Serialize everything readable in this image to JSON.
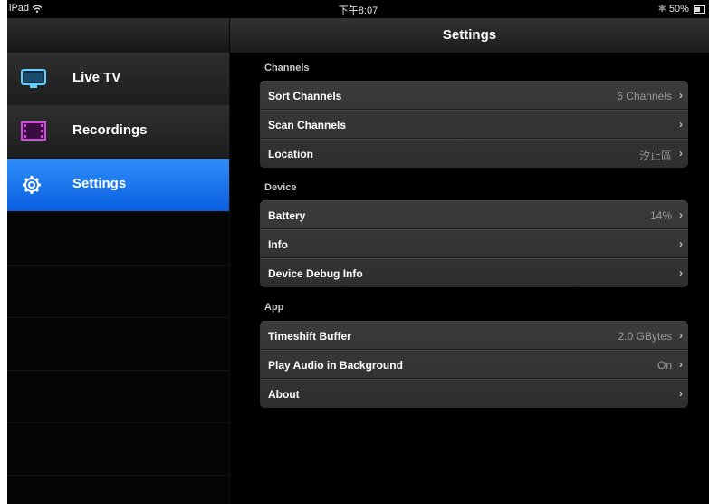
{
  "status_bar": {
    "device": "iPad",
    "wifi_icon": "wifi-icon",
    "time": "下午8:07",
    "bluetooth_icon": "bluetooth-icon",
    "battery": "50%"
  },
  "nav": {
    "title": "Settings"
  },
  "sidebar": {
    "items": [
      {
        "label": "Live TV",
        "icon": "tv-icon",
        "active": false
      },
      {
        "label": "Recordings",
        "icon": "film-icon",
        "active": false
      },
      {
        "label": "Settings",
        "icon": "gear-icon",
        "active": true
      }
    ]
  },
  "sections": [
    {
      "header": "Channels",
      "rows": [
        {
          "label": "Sort Channels",
          "value": "6 Channels"
        },
        {
          "label": "Scan Channels",
          "value": ""
        },
        {
          "label": "Location",
          "value": "汐止區"
        }
      ]
    },
    {
      "header": "Device",
      "rows": [
        {
          "label": "Battery",
          "value": "14%"
        },
        {
          "label": "Info",
          "value": ""
        },
        {
          "label": "Device Debug Info",
          "value": ""
        }
      ]
    },
    {
      "header": "App",
      "rows": [
        {
          "label": "Timeshift Buffer",
          "value": "2.0 GBytes"
        },
        {
          "label": "Play Audio in Background",
          "value": "On"
        },
        {
          "label": "About",
          "value": ""
        }
      ]
    }
  ],
  "colors": {
    "accent": "#1a7cf0",
    "background": "#000000",
    "cell": "#363636"
  }
}
